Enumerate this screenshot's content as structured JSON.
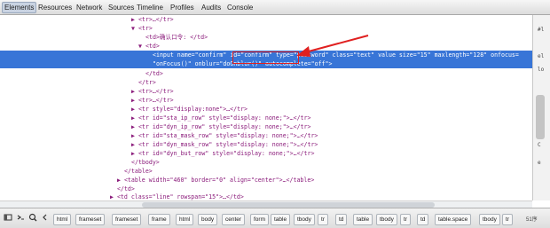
{
  "toolbar": {
    "tabs": [
      "Elements",
      "Resources",
      "Network",
      "Sources",
      "Timeline",
      "Profiles",
      "Audits",
      "Console"
    ]
  },
  "dom_lines": [
    "▶ <tr>…</tr>",
    "▼ <tr>",
    "<td>确认口令: </td>",
    "▼ <td>",
    "<input name=\"confirm\" id=\"confirm\" type=\"password\" class=\"text\" value size=\"15\" maxlength=\"128\" onfocus=",
    "\"onFocus()\" onblur=\"doOnblur()\" autocomplete=\"off\">",
    "</td>",
    "</tr>",
    "▶ <tr>…</tr>",
    "▶ <tr>…</tr>",
    "▶ <tr style=\"display:none\">…</tr>",
    "▶ <tr id=\"sta_ip_row\" style=\"display: none;\">…</tr>",
    "▶ <tr id=\"dyn_ip_row\" style=\"display: none;\">…</tr>",
    "▶ <tr id=\"sta_mask_row\" style=\"display: none;\">…</tr>",
    "▶ <tr id=\"dyn_mask_row\" style=\"display: none;\">…</tr>",
    "▶ <tr id=\"dyn_but_row\" style=\"display: none;\">…</tr>",
    "</tbody>",
    "</table>",
    "▶ <table width=\"460\" border=\"0\" align=\"center\">…</table>",
    "</td>",
    "▶ <td class=\"line\" rowspan=\"15\">…</td>"
  ],
  "side_text": [
    "#l",
    "el",
    "lo",
    "C",
    "e"
  ],
  "breadcrumbs": [
    "html",
    "frameset",
    "frameset",
    "frame",
    "html",
    "body",
    "center",
    "form",
    "table",
    "tbody",
    "tr",
    "td",
    "table",
    "tbody",
    "tr",
    "td",
    "table.space",
    "tbody",
    "tr"
  ],
  "footer_right": "51序"
}
